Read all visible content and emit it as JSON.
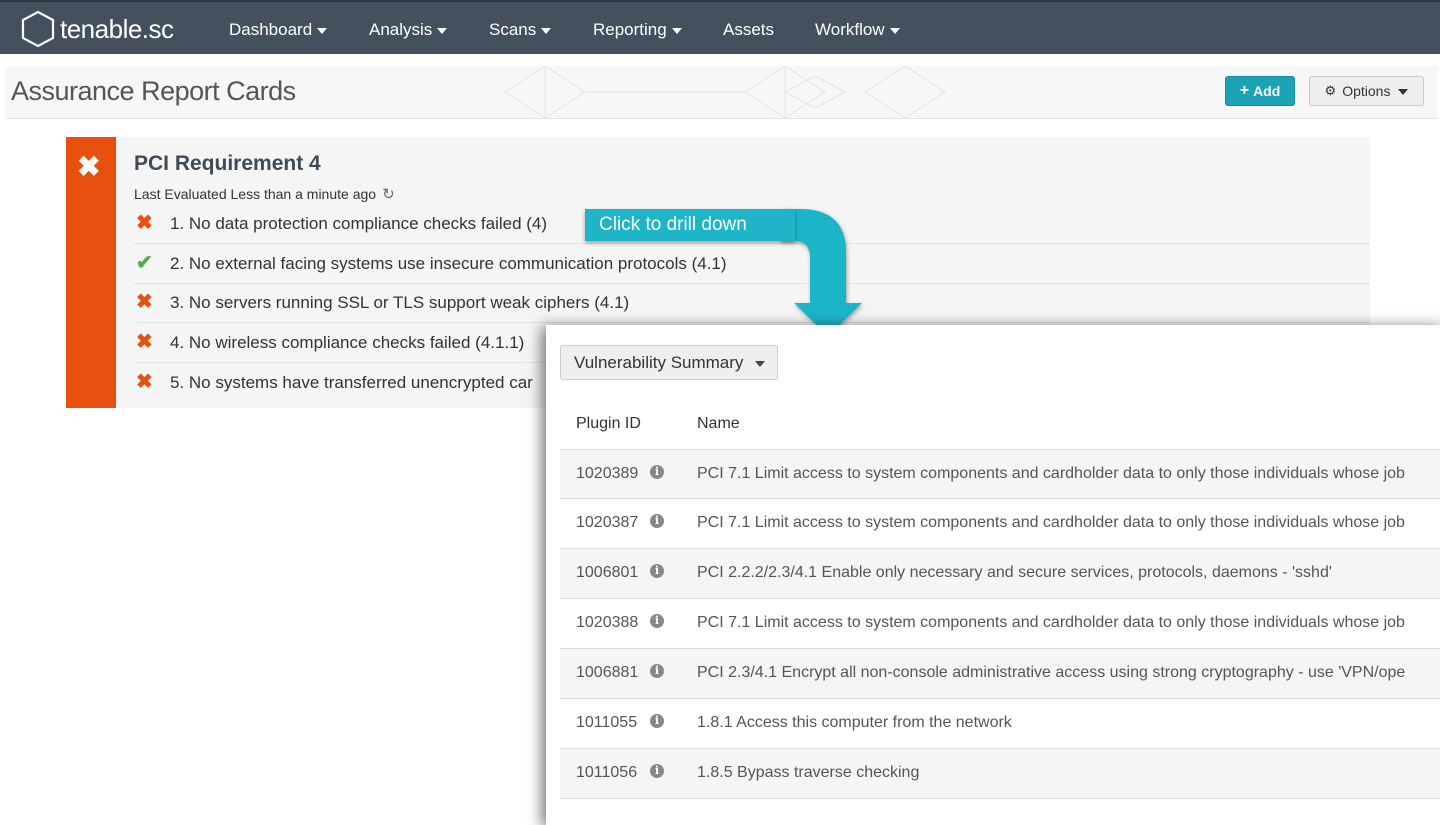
{
  "nav": {
    "logo_text": "tenable.sc",
    "items": [
      {
        "label": "Dashboard",
        "has_caret": true
      },
      {
        "label": "Analysis",
        "has_caret": true
      },
      {
        "label": "Scans",
        "has_caret": true
      },
      {
        "label": "Reporting",
        "has_caret": true
      },
      {
        "label": "Assets",
        "has_caret": false
      },
      {
        "label": "Workflow",
        "has_caret": true
      }
    ]
  },
  "header": {
    "title": "Assurance Report Cards",
    "add_label": "Add",
    "options_label": "Options"
  },
  "card": {
    "title": "PCI Requirement 4",
    "status": "fail",
    "last_evaluated": "Last Evaluated Less than a minute ago",
    "rows": [
      {
        "status": "fail",
        "text": "1. No data protection compliance checks failed (4)"
      },
      {
        "status": "pass",
        "text": "2. No external facing systems use insecure communication protocols (4.1)"
      },
      {
        "status": "fail",
        "text": "3. No servers running SSL or TLS support weak ciphers (4.1)"
      },
      {
        "status": "fail",
        "text": "4. No wireless compliance checks failed (4.1.1)"
      },
      {
        "status": "fail",
        "text": "5. No systems have transferred unencrypted car"
      }
    ]
  },
  "callout": {
    "text": "Click to drill down"
  },
  "drilldown": {
    "tool_label": "Vulnerability Summary",
    "columns": [
      "Plugin ID",
      "Name"
    ],
    "rows": [
      {
        "plugin_id": "1020389",
        "name": "PCI 7.1 Limit access to system components and cardholder data to only those individuals whose job"
      },
      {
        "plugin_id": "1020387",
        "name": "PCI 7.1 Limit access to system components and cardholder data to only those individuals whose job"
      },
      {
        "plugin_id": "1006801",
        "name": "PCI 2.2.2/2.3/4.1 Enable only necessary and secure services, protocols, daemons - 'sshd'"
      },
      {
        "plugin_id": "1020388",
        "name": "PCI 7.1 Limit access to system components and cardholder data to only those individuals whose job"
      },
      {
        "plugin_id": "1006881",
        "name": "PCI 2.3/4.1 Encrypt all non-console administrative access using strong cryptography - use 'VPN/ope"
      },
      {
        "plugin_id": "1011055",
        "name": "1.8.1 Access this computer from the network"
      },
      {
        "plugin_id": "1011056",
        "name": "1.8.5 Bypass traverse checking"
      }
    ]
  },
  "colors": {
    "nav_bg": "#44505e",
    "accent_teal": "#1ba3b5",
    "fail": "#e8500f",
    "pass": "#4cae4c",
    "callout": "#1fb5c8"
  }
}
